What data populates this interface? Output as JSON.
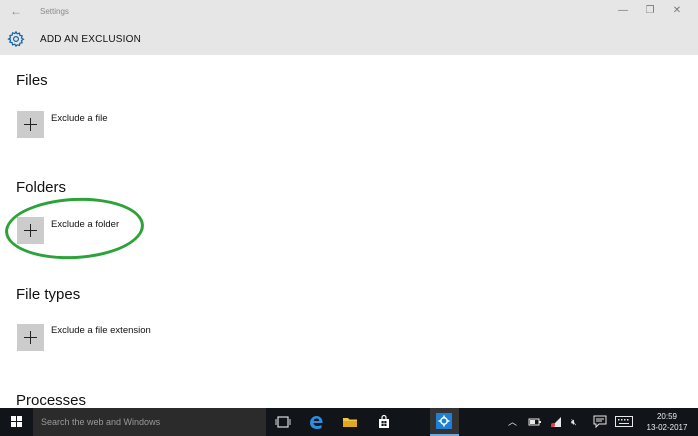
{
  "window": {
    "title": "Settings",
    "back_glyph": "←",
    "minimize_glyph": "—",
    "maximize_glyph": "❐",
    "close_glyph": "✕"
  },
  "header": {
    "title": "ADD AN EXCLUSION",
    "icon": "gear-icon",
    "accent_color": "#0a64ad"
  },
  "sections": {
    "files": {
      "title": "Files",
      "action_label": "Exclude a file"
    },
    "folders": {
      "title": "Folders",
      "action_label": "Exclude a folder"
    },
    "file_types": {
      "title": "File types",
      "action_label": "Exclude a file extension"
    },
    "processes": {
      "title": "Processes"
    }
  },
  "annotation": {
    "highlight_color": "#2ca339"
  },
  "taskbar": {
    "search_placeholder": "Search the web and Windows",
    "time": "20:59",
    "date": "13-02-2017",
    "tray_icons": [
      "chevron-up-icon",
      "battery-icon",
      "network-icon",
      "volume-muted-icon",
      "action-center-icon",
      "keyboard-icon"
    ],
    "pinned_apps": [
      "task-view-icon",
      "edge-icon",
      "file-explorer-icon",
      "store-icon",
      "settings-icon"
    ]
  }
}
